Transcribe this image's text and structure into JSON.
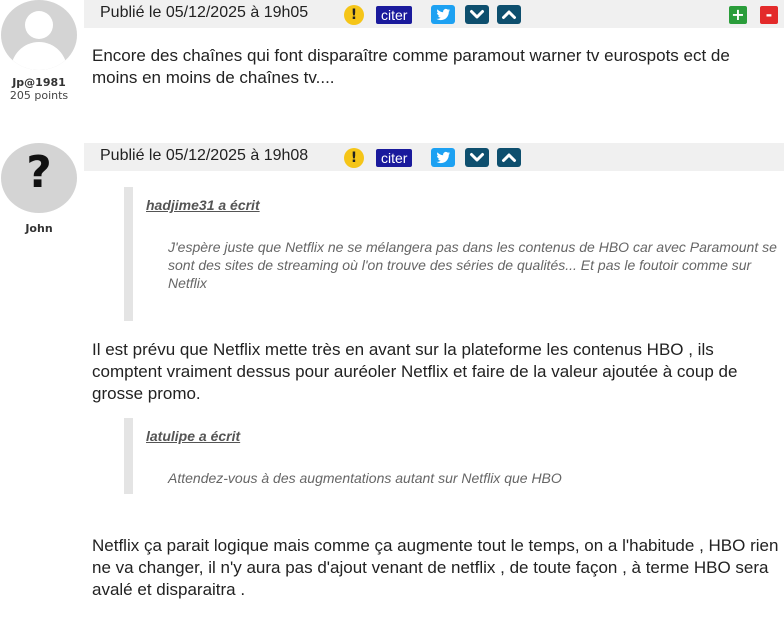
{
  "posts": [
    {
      "user": {
        "name": "Jp@1981",
        "points": "205 points",
        "avatar": "default-user-silhouette"
      },
      "date": "Publié le 05/12/2025 à 19h05",
      "actions": {
        "warn": "!",
        "cite": "citer",
        "plus": "+",
        "minus": "-"
      },
      "text": "Encore des chaînes qui font disparaître comme paramout warner tv eurospots ect de moins en moins de chaînes tv...."
    },
    {
      "user": {
        "name": "John",
        "avatar": "question-mark-silhouette",
        "avatar_glyph": "?"
      },
      "date": "Publié le 05/12/2025 à 19h08",
      "actions": {
        "warn": "!",
        "cite": "citer"
      },
      "quotes": [
        {
          "author": "hadjime31 a écrit",
          "text": "J'espère juste que Netflix ne se mélangera pas dans les contenus de HBO car avec Paramount se sont des sites de streaming où l'on trouve des séries de qualités... Et pas le foutoir comme sur Netflix"
        },
        {
          "author": "latulipe a écrit",
          "text": "Attendez-vous à des augmentations autant sur Netflix que HBO"
        }
      ],
      "replies": [
        "Il est prévu que Netflix mette très en avant sur la plateforme les contenus HBO , ils comptent vraiment dessus pour auréoler Netflix et faire de la valeur ajoutée à coup de grosse promo.",
        "Netflix ça parait logique mais comme ça augmente tout le temps, on a l'habitude , HBO rien ne va changer, il n'y aura pas d'ajout venant de netflix , de toute façon , à terme HBO sera avalé et disparaitra ."
      ]
    }
  ],
  "colors": {
    "header_bg": "#f0f0f0",
    "warn": "#f5c518",
    "cite": "#1a1a9c",
    "twitter": "#1da1f2",
    "vote_arrows": "#0e4f6e",
    "plus": "#2a9d3a",
    "minus": "#e32a2a",
    "quote_border": "#e4e4e4"
  }
}
